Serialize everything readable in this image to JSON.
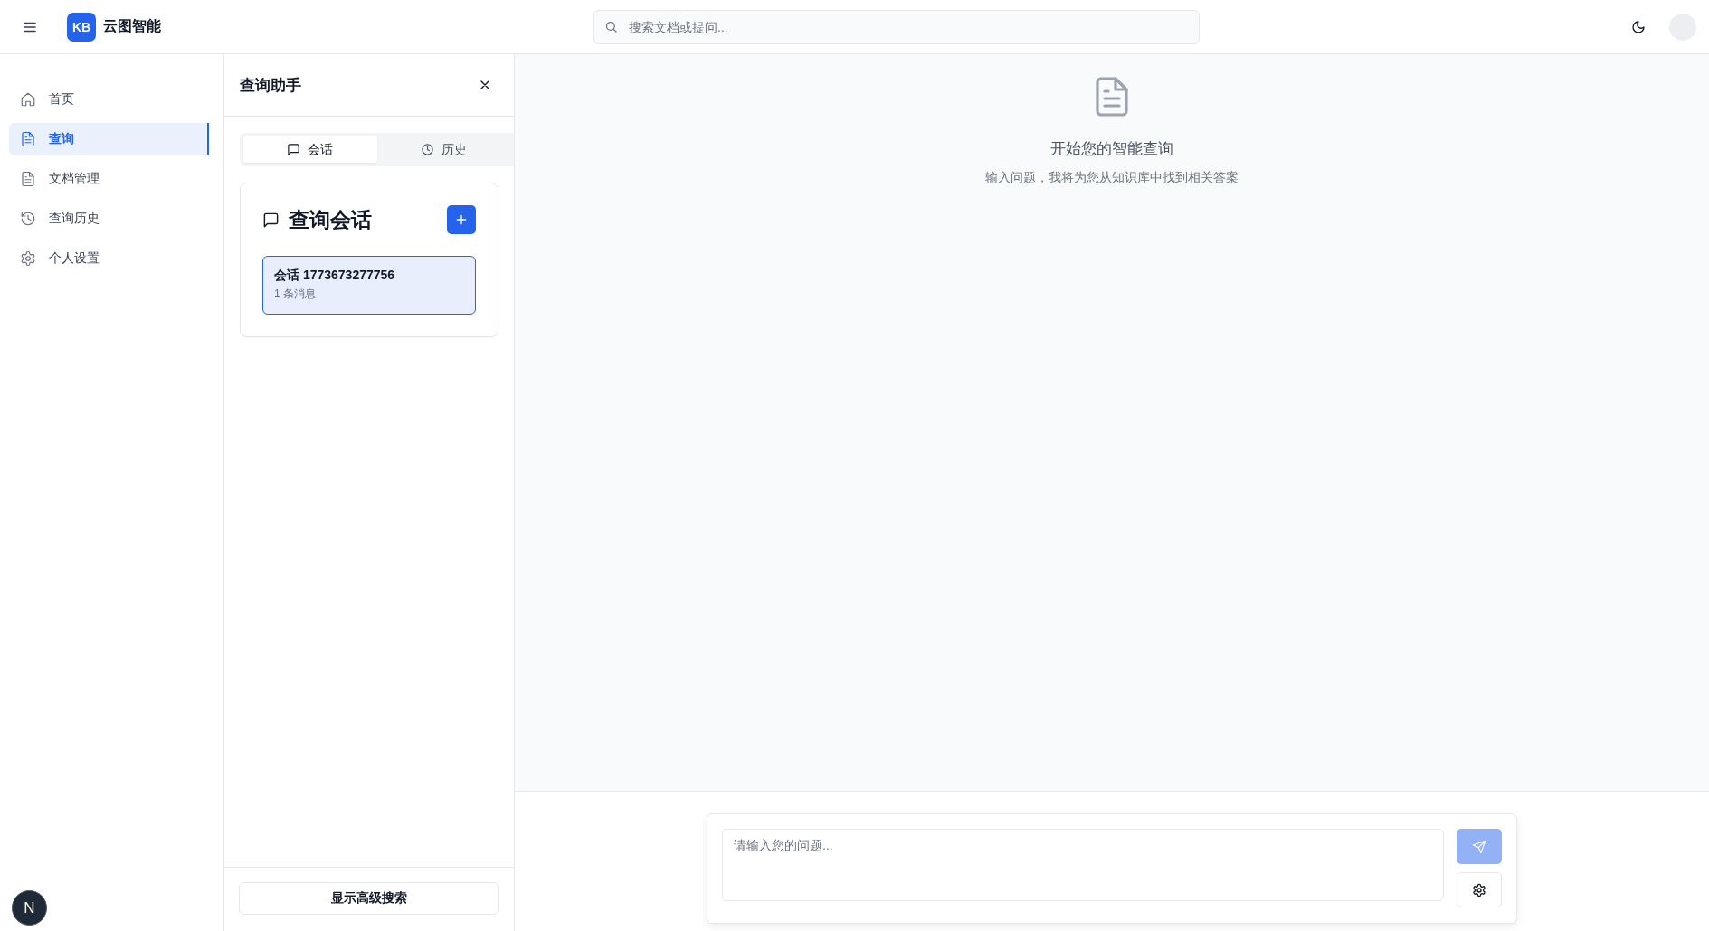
{
  "header": {
    "logo": "KB",
    "app_name": "云图智能",
    "search": {
      "placeholder": "搜索文档或提问..."
    }
  },
  "sidebar": {
    "items": [
      {
        "label": "首页",
        "kind": "home",
        "selected": false
      },
      {
        "label": "查询",
        "kind": "document",
        "selected": true
      },
      {
        "label": "文档管理",
        "kind": "document",
        "selected": false
      },
      {
        "label": "查询历史",
        "kind": "history",
        "selected": false
      },
      {
        "label": "个人设置",
        "kind": "settings",
        "selected": false
      }
    ]
  },
  "panel": {
    "title": "查询助手",
    "tabs": [
      {
        "label": "会话",
        "kind": "chat",
        "selected": true
      },
      {
        "label": "历史",
        "kind": "history",
        "selected": false
      }
    ],
    "sessions_card": {
      "title": "查询会话",
      "sessions": [
        {
          "title": "会话 1773673277756",
          "meta": "1 条消息",
          "selected": true
        }
      ]
    },
    "advanced_button": "显示高级搜索"
  },
  "main": {
    "empty_state": {
      "title": "开始您的智能查询",
      "subtitle": "输入问题，我将为您从知识库中找到相关答案"
    },
    "composer": {
      "placeholder": "请输入您的问题...",
      "send_disabled": true
    }
  },
  "dev_badge": "N"
}
